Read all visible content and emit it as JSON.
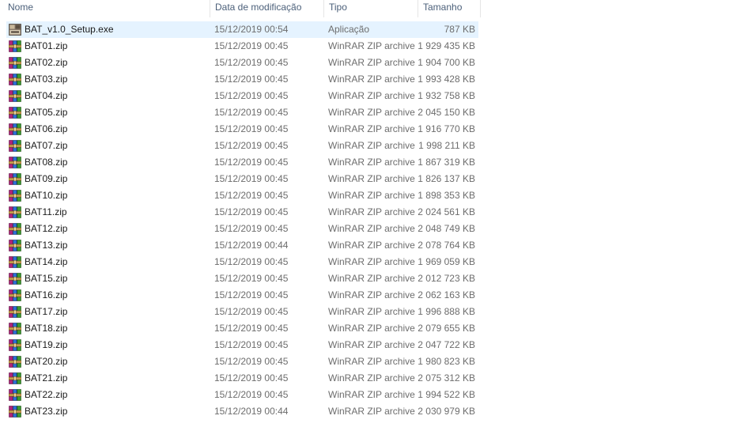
{
  "columns": {
    "name": "Nome",
    "date": "Data de modificação",
    "type": "Tipo",
    "size": "Tamanho"
  },
  "files": [
    {
      "name": "BAT_v1.0_Setup.exe",
      "date": "15/12/2019 00:54",
      "type": "Aplicação",
      "size": "787 KB",
      "icon": "setup-exe-icon",
      "selected": true
    },
    {
      "name": "BAT01.zip",
      "date": "15/12/2019 00:45",
      "type": "WinRAR ZIP archive",
      "size": "1 929 435 KB",
      "icon": "winrar-zip-icon"
    },
    {
      "name": "BAT02.zip",
      "date": "15/12/2019 00:45",
      "type": "WinRAR ZIP archive",
      "size": "1 904 700 KB",
      "icon": "winrar-zip-icon"
    },
    {
      "name": "BAT03.zip",
      "date": "15/12/2019 00:45",
      "type": "WinRAR ZIP archive",
      "size": "1 993 428 KB",
      "icon": "winrar-zip-icon"
    },
    {
      "name": "BAT04.zip",
      "date": "15/12/2019 00:45",
      "type": "WinRAR ZIP archive",
      "size": "1 932 758 KB",
      "icon": "winrar-zip-icon"
    },
    {
      "name": "BAT05.zip",
      "date": "15/12/2019 00:45",
      "type": "WinRAR ZIP archive",
      "size": "2 045 150 KB",
      "icon": "winrar-zip-icon"
    },
    {
      "name": "BAT06.zip",
      "date": "15/12/2019 00:45",
      "type": "WinRAR ZIP archive",
      "size": "1 916 770 KB",
      "icon": "winrar-zip-icon"
    },
    {
      "name": "BAT07.zip",
      "date": "15/12/2019 00:45",
      "type": "WinRAR ZIP archive",
      "size": "1 998 211 KB",
      "icon": "winrar-zip-icon"
    },
    {
      "name": "BAT08.zip",
      "date": "15/12/2019 00:45",
      "type": "WinRAR ZIP archive",
      "size": "1 867 319 KB",
      "icon": "winrar-zip-icon"
    },
    {
      "name": "BAT09.zip",
      "date": "15/12/2019 00:45",
      "type": "WinRAR ZIP archive",
      "size": "1 826 137 KB",
      "icon": "winrar-zip-icon"
    },
    {
      "name": "BAT10.zip",
      "date": "15/12/2019 00:45",
      "type": "WinRAR ZIP archive",
      "size": "1 898 353 KB",
      "icon": "winrar-zip-icon"
    },
    {
      "name": "BAT11.zip",
      "date": "15/12/2019 00:45",
      "type": "WinRAR ZIP archive",
      "size": "2 024 561 KB",
      "icon": "winrar-zip-icon"
    },
    {
      "name": "BAT12.zip",
      "date": "15/12/2019 00:45",
      "type": "WinRAR ZIP archive",
      "size": "2 048 749 KB",
      "icon": "winrar-zip-icon"
    },
    {
      "name": "BAT13.zip",
      "date": "15/12/2019 00:44",
      "type": "WinRAR ZIP archive",
      "size": "2 078 764 KB",
      "icon": "winrar-zip-icon"
    },
    {
      "name": "BAT14.zip",
      "date": "15/12/2019 00:45",
      "type": "WinRAR ZIP archive",
      "size": "1 969 059 KB",
      "icon": "winrar-zip-icon"
    },
    {
      "name": "BAT15.zip",
      "date": "15/12/2019 00:45",
      "type": "WinRAR ZIP archive",
      "size": "2 012 723 KB",
      "icon": "winrar-zip-icon"
    },
    {
      "name": "BAT16.zip",
      "date": "15/12/2019 00:45",
      "type": "WinRAR ZIP archive",
      "size": "2 062 163 KB",
      "icon": "winrar-zip-icon"
    },
    {
      "name": "BAT17.zip",
      "date": "15/12/2019 00:45",
      "type": "WinRAR ZIP archive",
      "size": "1 996 888 KB",
      "icon": "winrar-zip-icon"
    },
    {
      "name": "BAT18.zip",
      "date": "15/12/2019 00:45",
      "type": "WinRAR ZIP archive",
      "size": "2 079 655 KB",
      "icon": "winrar-zip-icon"
    },
    {
      "name": "BAT19.zip",
      "date": "15/12/2019 00:45",
      "type": "WinRAR ZIP archive",
      "size": "2 047 722 KB",
      "icon": "winrar-zip-icon"
    },
    {
      "name": "BAT20.zip",
      "date": "15/12/2019 00:45",
      "type": "WinRAR ZIP archive",
      "size": "1 980 823 KB",
      "icon": "winrar-zip-icon"
    },
    {
      "name": "BAT21.zip",
      "date": "15/12/2019 00:45",
      "type": "WinRAR ZIP archive",
      "size": "2 075 312 KB",
      "icon": "winrar-zip-icon"
    },
    {
      "name": "BAT22.zip",
      "date": "15/12/2019 00:45",
      "type": "WinRAR ZIP archive",
      "size": "1 994 522 KB",
      "icon": "winrar-zip-icon"
    },
    {
      "name": "BAT23.zip",
      "date": "15/12/2019 00:44",
      "type": "WinRAR ZIP archive",
      "size": "2 030 979 KB",
      "icon": "winrar-zip-icon"
    }
  ],
  "colors": {
    "selection": "#e5f3ff",
    "header_text": "#4c607a",
    "secondary_text": "#6d6d6d"
  }
}
